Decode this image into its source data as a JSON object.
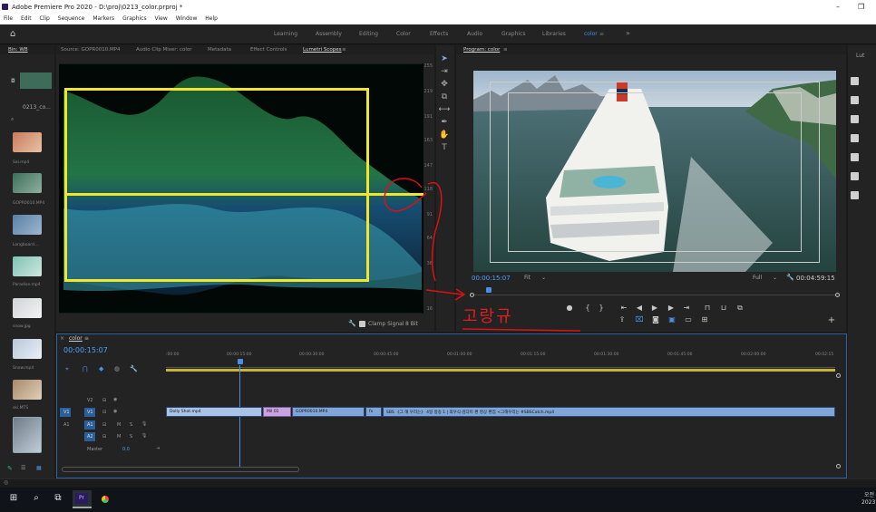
{
  "app": {
    "title": "Adobe Premiere Pro 2020 - D:\\proj\\0213_color.prproj *",
    "window_controls": [
      "–",
      "❐"
    ]
  },
  "menu": [
    "File",
    "Edit",
    "Clip",
    "Sequence",
    "Markers",
    "Graphics",
    "View",
    "Window",
    "Help"
  ],
  "workspaces": {
    "home_icon": "home-icon",
    "items": [
      "Learning",
      "Assembly",
      "Editing",
      "Color",
      "Effects",
      "Audio",
      "Graphics",
      "Libraries",
      "color"
    ],
    "active": "color",
    "overflow": "»"
  },
  "project_panel": {
    "tab": "Bin: WB",
    "folder_label": "0213_co...",
    "items": [
      "Sai.mp4",
      "GOPR0010.MP4",
      "Longboard...",
      "Paradise.mp4",
      "snow.jpg",
      "Snow.mp4",
      "ski.MTS",
      ""
    ]
  },
  "source_tabs": [
    "Source: GOPR0010.MP4",
    "Audio Clip Mixer: color",
    "Metadata",
    "Effect Controls",
    "Lumetri Scopes"
  ],
  "scope": {
    "ticks": [
      "255",
      "219",
      "191",
      "163",
      "147",
      "118",
      "91",
      "64",
      "36",
      "16"
    ],
    "clamp_label": "Clamp Signal",
    "bit_depth": "8 Bit"
  },
  "program": {
    "tab": "Program: color",
    "timecode": "00:00:15:07",
    "fit": "Fit",
    "quality": "Full",
    "duration": "00:04:59:15"
  },
  "annotation": {
    "text": "고랑규"
  },
  "timeline": {
    "tab": "color",
    "timecode": "00:00:15:07",
    "ruler": [
      ":00:00",
      "00:00:15:00",
      "00:00:30:00",
      "00:00:45:00",
      "00:01:00:00",
      "00:01:15:00",
      "00:01:30:00",
      "00:01:45:00",
      "00:02:00:00",
      "00:02:15"
    ],
    "tracks": {
      "v2": "V2",
      "v1": "V1",
      "a1": "A1",
      "a2": "A2",
      "master": "Master",
      "master_val": "0.0",
      "m": "M",
      "s": "S"
    },
    "clips": {
      "c1": "Dolly Shot.mp4",
      "c2": "Mil 01",
      "c3": "GOPR0010.MP4",
      "c4": "fx",
      "c5": "SBS 《그 해 우리는》 4일 방송 1 | 최우식·김다미 편 영상 편집 <그해우리는 #SBSCatch.mp4"
    }
  },
  "right_panel": {
    "tab": "Lut"
  },
  "taskbar": {
    "clock_line1": "오전",
    "clock_line2": "2023"
  }
}
